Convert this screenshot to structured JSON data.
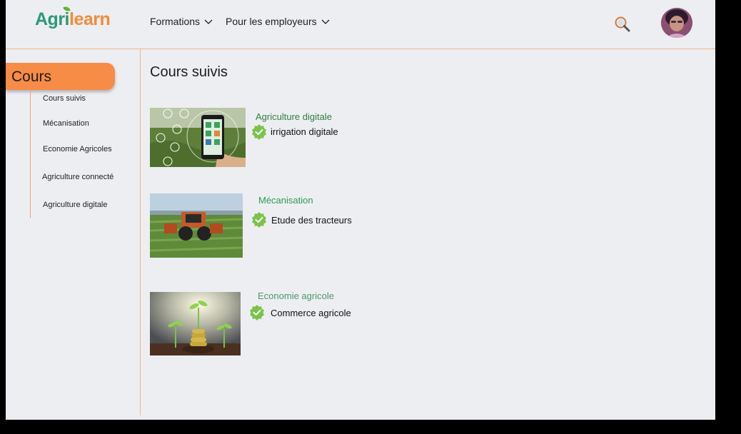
{
  "header": {
    "logo_part1": "Agri",
    "logo_part2": "learn",
    "nav": [
      {
        "label": "Formations"
      },
      {
        "label": "Pour les employeurs"
      }
    ]
  },
  "sidebar": {
    "section_label": "Cours",
    "items": [
      {
        "label": "Cours suivis"
      },
      {
        "label": "Mécanisation"
      },
      {
        "label": "Economie Agricoles"
      },
      {
        "label": "Agriculture connecté"
      },
      {
        "label": "Agriculture digitale"
      }
    ]
  },
  "main": {
    "title": "Cours suivis",
    "courses": [
      {
        "category": "Agriculture digitale",
        "title": "irrigation digitale"
      },
      {
        "category": "Mécanisation",
        "title": "Etude des tracteurs"
      },
      {
        "category": "Economie agricole",
        "title": "Commerce agricole"
      }
    ]
  },
  "colors": {
    "accent": "#f78c46",
    "brand_green": "#2a9a72",
    "category_green_1": "#2f7f3c",
    "category_green_2": "#2f9a53",
    "category_green_3": "#4a9a6a",
    "check_green": "#7cc34a",
    "background": "#edeef2"
  }
}
